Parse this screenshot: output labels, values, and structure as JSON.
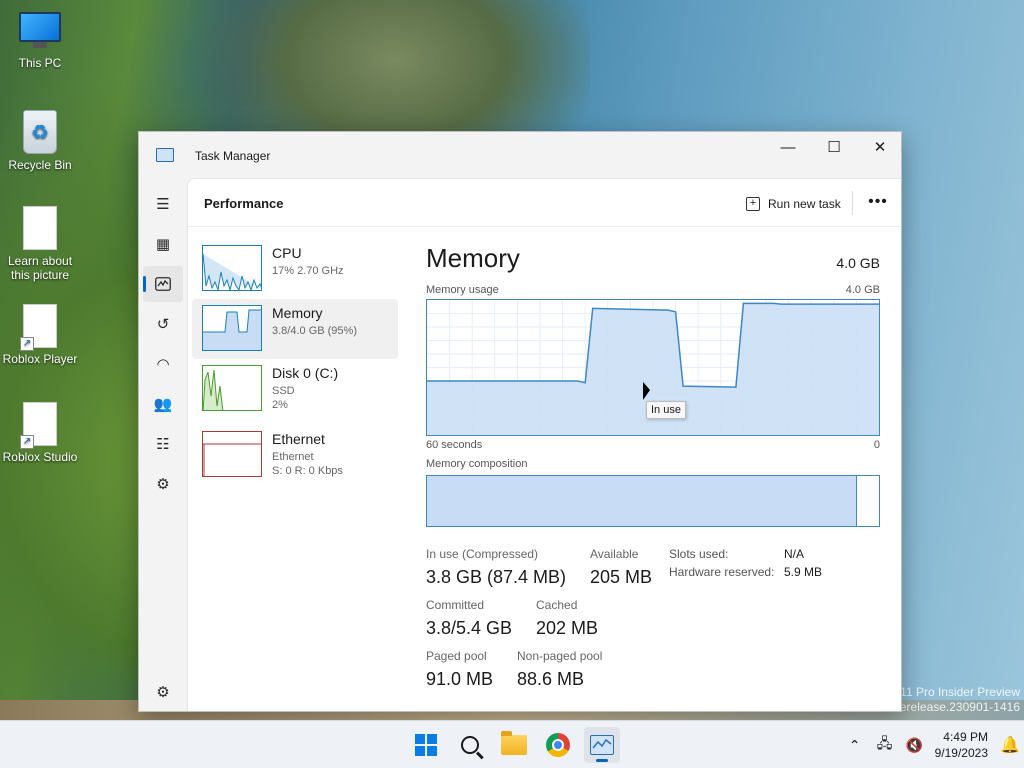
{
  "desktop": {
    "icons": [
      {
        "label": "This PC"
      },
      {
        "label": "Recycle Bin"
      },
      {
        "label": "Learn about this picture"
      },
      {
        "label": "Roblox Player"
      },
      {
        "label": "Roblox Studio"
      }
    ],
    "watermark_line1": "11 Pro Insider Preview",
    "watermark_line2": "rerelease.230901-1416"
  },
  "window": {
    "title": "Task Manager",
    "page_title": "Performance",
    "run_new_task": "Run new task",
    "more": "•••",
    "controls": {
      "minimize": "—",
      "maximize": "☐",
      "close": "✕"
    }
  },
  "resources": [
    {
      "name": "CPU",
      "sub1": "17% 2.70 GHz",
      "sub2": ""
    },
    {
      "name": "Memory",
      "sub1": "3.8/4.0 GB (95%)",
      "sub2": ""
    },
    {
      "name": "Disk 0 (C:)",
      "sub1": "SSD",
      "sub2": "2%"
    },
    {
      "name": "Ethernet",
      "sub1": "Ethernet",
      "sub2": "S: 0 R: 0 Kbps"
    }
  ],
  "memory": {
    "title": "Memory",
    "total": "4.0 GB",
    "usage_label": "Memory usage",
    "usage_max": "4.0 GB",
    "axis_left": "60 seconds",
    "axis_right": "0",
    "composition_label": "Memory composition",
    "tooltip": "In use",
    "in_use_label": "In use (Compressed)",
    "in_use_value": "3.8 GB (87.4 MB)",
    "available_label": "Available",
    "available_value": "205 MB",
    "committed_label": "Committed",
    "committed_value": "3.8/5.4 GB",
    "cached_label": "Cached",
    "cached_value": "202 MB",
    "paged_label": "Paged pool",
    "paged_value": "91.0 MB",
    "nonpaged_label": "Non-paged pool",
    "nonpaged_value": "88.6 MB",
    "slots_label": "Slots used:",
    "slots_value": "N/A",
    "reserved_label": "Hardware reserved:",
    "reserved_value": "5.9 MB"
  },
  "chart_data": {
    "type": "area",
    "title": "Memory usage",
    "xlabel": "60 seconds",
    "ylim": [
      0,
      4.0
    ],
    "x": [
      60,
      40,
      39,
      38,
      28,
      27,
      26,
      19,
      18,
      14,
      13,
      12,
      0
    ],
    "values": [
      1.6,
      1.6,
      1.55,
      3.75,
      3.7,
      3.65,
      1.45,
      1.42,
      3.9,
      3.9,
      3.88,
      3.88,
      3.88
    ]
  },
  "taskbar": {
    "time": "4:49 PM",
    "date": "9/19/2023",
    "tray_chevron": "⌃"
  },
  "colors": {
    "accent": "#0067c0",
    "graph_line": "#3e87c4",
    "graph_fill": "#c8ddf5"
  }
}
